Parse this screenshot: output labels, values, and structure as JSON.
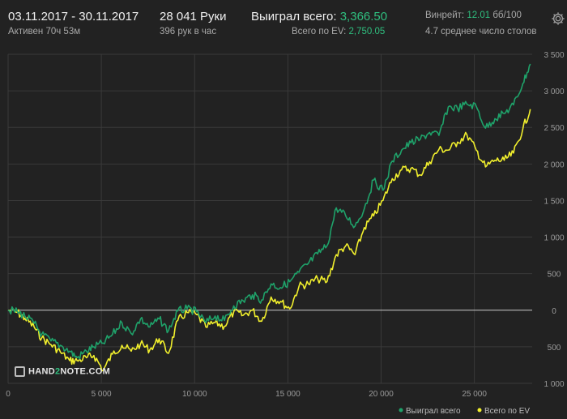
{
  "header": {
    "date_range": "03.11.2017 - 30.11.2017",
    "active": "Активен 70ч 53м",
    "hands": "28 041 Руки",
    "hands_per_hour": "396 рук в час",
    "won_label": "Выиграл всего:",
    "won_value": "3,366.50",
    "ev_label": "Всего по EV:",
    "ev_value": "2,750.05",
    "winrate_label": "Винрейт:",
    "winrate_value": "12.01",
    "winrate_unit": "бб/100",
    "tables": "4.7 среднее число столов"
  },
  "settings_icon": "gear-icon",
  "logo": {
    "prefix": "HAND",
    "mid": "2",
    "suffix": "NOTE.COM"
  },
  "colors": {
    "background": "#222222",
    "won": "#1fa26a",
    "ev": "#f1ef2d",
    "grid": "#3a3a3a",
    "zero": "#c9c9c9"
  },
  "chart_data": {
    "type": "line",
    "title": "",
    "xlabel": "",
    "ylabel": "",
    "xlim": [
      0,
      28100
    ],
    "ylim": [
      -1000,
      3500
    ],
    "x_ticks": [
      0,
      5000,
      10000,
      15000,
      20000,
      25000
    ],
    "x_tick_labels": [
      "0",
      "5 000",
      "10 000",
      "15 000",
      "20 000",
      "25 000"
    ],
    "y_ticks": [
      3500,
      3000,
      2500,
      2000,
      1500,
      1000,
      500,
      0,
      -500,
      -1000
    ],
    "y_tick_labels": [
      "3 500",
      "3 000",
      "2 500",
      "2 000",
      "1 500",
      "1 000",
      "500",
      "0",
      "500",
      "1 000"
    ],
    "grid": true,
    "legend_position": "bottom-right",
    "series": [
      {
        "name": "Выиграл всего",
        "color": "#1fa26a",
        "x": [
          0,
          500,
          900,
          1400,
          1800,
          2300,
          2800,
          3300,
          3700,
          4200,
          4600,
          5100,
          5600,
          6100,
          6600,
          7100,
          7600,
          8100,
          8600,
          9100,
          9600,
          10100,
          10600,
          11100,
          11600,
          12100,
          12600,
          13100,
          13600,
          14100,
          14600,
          15100,
          15600,
          16100,
          16600,
          17100,
          17600,
          18100,
          18600,
          19100,
          19600,
          20100,
          20600,
          21100,
          21600,
          22100,
          22600,
          23100,
          23600,
          24100,
          24600,
          25100,
          25600,
          26100,
          26600,
          27100,
          27600,
          28000
        ],
        "y": [
          0,
          -20,
          -80,
          -180,
          -330,
          -420,
          -480,
          -560,
          -650,
          -560,
          -500,
          -450,
          -330,
          -170,
          -320,
          -120,
          -230,
          -120,
          -280,
          -10,
          20,
          -20,
          -170,
          -80,
          -140,
          60,
          130,
          210,
          140,
          360,
          310,
          390,
          520,
          640,
          770,
          880,
          1400,
          1290,
          1150,
          1390,
          1780,
          1640,
          2040,
          2190,
          2290,
          2340,
          2430,
          2390,
          2780,
          2760,
          2820,
          2790,
          2490,
          2620,
          2690,
          2810,
          3100,
          3366.5
        ]
      },
      {
        "name": "Всего по EV",
        "color": "#f1ef2d",
        "x": [
          0,
          500,
          900,
          1400,
          1800,
          2300,
          2800,
          3300,
          3700,
          4200,
          4600,
          5100,
          5600,
          6100,
          6600,
          7100,
          7600,
          8100,
          8600,
          9100,
          9600,
          10100,
          10600,
          11100,
          11600,
          12100,
          12600,
          13100,
          13600,
          14100,
          14600,
          15100,
          15600,
          16100,
          16600,
          17100,
          17600,
          18100,
          18600,
          19100,
          19600,
          20100,
          20600,
          21100,
          21600,
          22100,
          22600,
          23100,
          23600,
          24100,
          24600,
          25100,
          25600,
          26100,
          26600,
          27100,
          27600,
          28000
        ],
        "y": [
          0,
          -30,
          -110,
          -230,
          -380,
          -470,
          -570,
          -690,
          -690,
          -650,
          -620,
          -820,
          -600,
          -480,
          -560,
          -460,
          -540,
          -390,
          -590,
          -140,
          -30,
          -60,
          -230,
          -170,
          -220,
          -20,
          -70,
          0,
          -150,
          180,
          120,
          20,
          330,
          360,
          430,
          390,
          760,
          880,
          760,
          1130,
          1290,
          1500,
          1800,
          1920,
          1940,
          1850,
          2030,
          2200,
          2190,
          2300,
          2400,
          2190,
          1960,
          2050,
          2050,
          2150,
          2480,
          2750.05
        ]
      }
    ]
  }
}
